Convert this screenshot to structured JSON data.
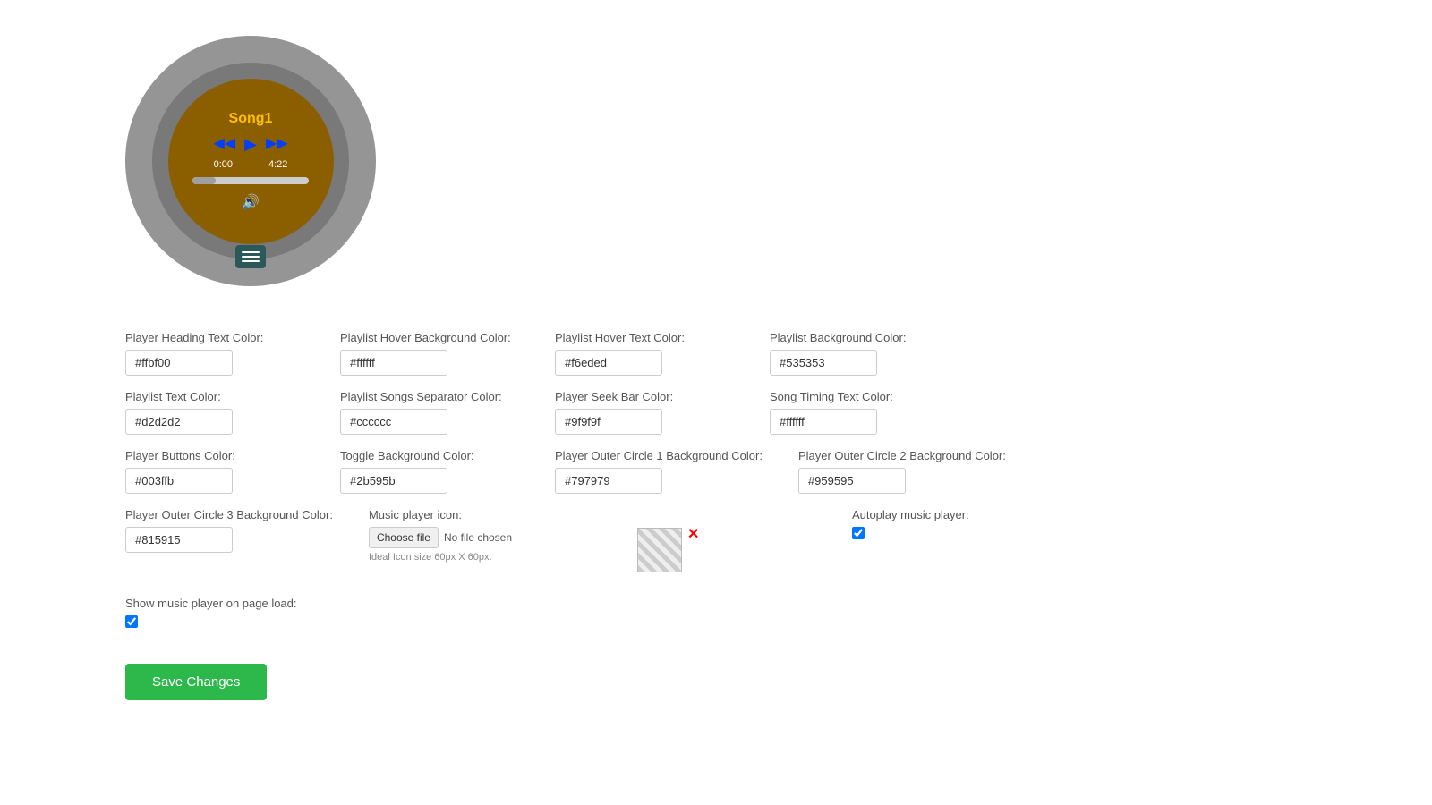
{
  "player": {
    "title": "Song1",
    "time_current": "0:00",
    "time_total": "4:22"
  },
  "settings": {
    "rows": [
      [
        {
          "label": "Player Heading Text Color:",
          "value": "#ffbf00",
          "name": "player-heading-text-color"
        },
        {
          "label": "Playlist Hover Background Color:",
          "value": "#ffffff",
          "name": "playlist-hover-bg-color"
        },
        {
          "label": "Playlist Hover Text Color:",
          "value": "#f6eded",
          "name": "playlist-hover-text-color"
        },
        {
          "label": "Playlist Background Color:",
          "value": "#535353",
          "name": "playlist-bg-color"
        }
      ],
      [
        {
          "label": "Playlist Text Color:",
          "value": "#d2d2d2",
          "name": "playlist-text-color"
        },
        {
          "label": "Playlist Songs Separator Color:",
          "value": "#cccccc",
          "name": "playlist-separator-color"
        },
        {
          "label": "Player Seek Bar Color:",
          "value": "#9f9f9f",
          "name": "player-seekbar-color"
        },
        {
          "label": "Song Timing Text Color:",
          "value": "#ffffff",
          "name": "song-timing-text-color"
        }
      ],
      [
        {
          "label": "Player Buttons Color:",
          "value": "#003ffb",
          "name": "player-buttons-color"
        },
        {
          "label": "Toggle Background Color:",
          "value": "#2b595b",
          "name": "toggle-bg-color"
        },
        {
          "label": "Player Outer Circle 1 Background Color:",
          "value": "#797979",
          "name": "outer-circle1-color"
        },
        {
          "label": "Player Outer Circle 2 Background Color:",
          "value": "#959595",
          "name": "outer-circle2-color"
        }
      ],
      [
        {
          "label": "Player Outer Circle 3 Background Color:",
          "value": "#815915",
          "name": "outer-circle3-color"
        }
      ]
    ],
    "music_icon_label": "Music player icon:",
    "file_choose_label": "Choose file",
    "file_no_chosen": "No file chosen",
    "file_hint": "Ideal Icon size 60px X 60px.",
    "autoplay_label": "Autoplay music player:",
    "show_on_load_label": "Show music player on page load:",
    "save_label": "Save Changes"
  }
}
